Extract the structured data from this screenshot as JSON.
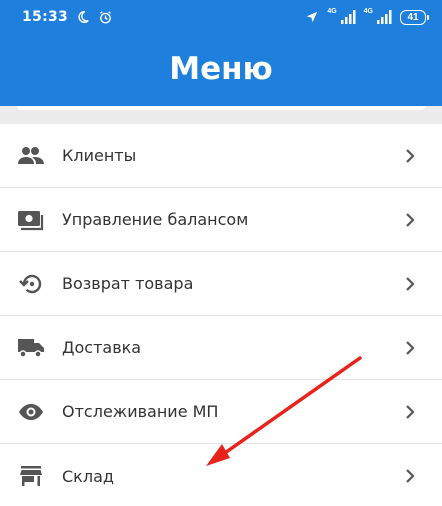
{
  "status_bar": {
    "time": "15:33",
    "net1": "4G",
    "net2": "4G",
    "battery": "41",
    "icons": [
      "moon-icon",
      "alarm-icon",
      "location-icon",
      "signal-icon",
      "battery-icon"
    ]
  },
  "header": {
    "title": "Меню"
  },
  "menu": {
    "items": [
      {
        "label": "Клиенты",
        "icon": "people-icon"
      },
      {
        "label": "Управление балансом",
        "icon": "wallet-icon"
      },
      {
        "label": "Возврат товара",
        "icon": "return-icon"
      },
      {
        "label": "Доставка",
        "icon": "truck-icon"
      },
      {
        "label": "Отслеживание МП",
        "icon": "eye-icon"
      },
      {
        "label": "Склад",
        "icon": "store-icon"
      }
    ]
  },
  "colors": {
    "primary": "#1e7fdc",
    "icon": "#555555",
    "chevron": "#555555",
    "annotation_arrow": "#e8231b"
  }
}
